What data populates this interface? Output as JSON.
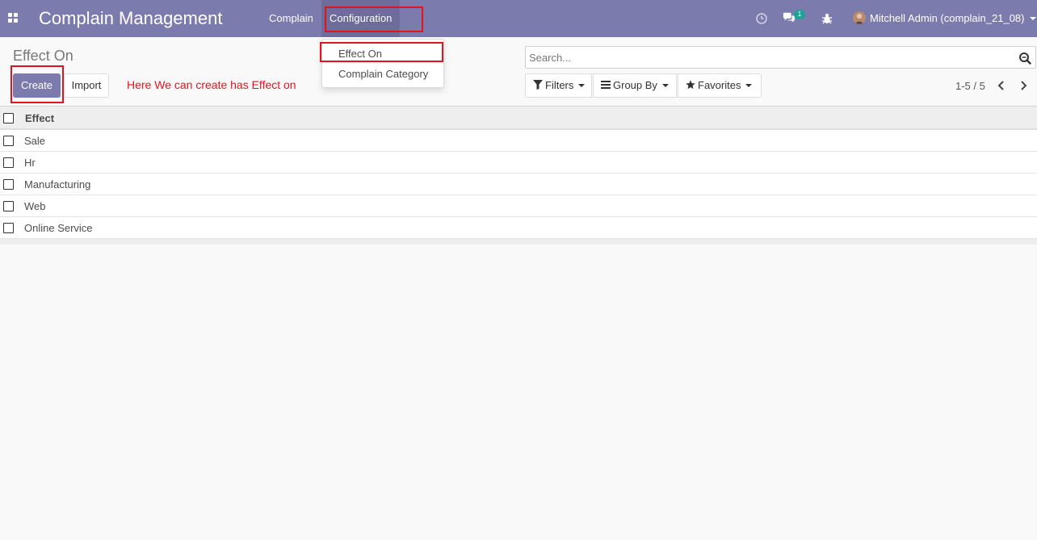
{
  "navbar": {
    "app_title": "Complain Management",
    "menu": [
      "Complain",
      "Configuration"
    ],
    "message_count": "1",
    "user_name": "Mitchell Admin (complain_21_08)"
  },
  "dropdown": {
    "items": [
      "Effect On",
      "Complain Category"
    ]
  },
  "control_panel": {
    "breadcrumb": "Effect On",
    "create_label": "Create",
    "import_label": "Import",
    "annotation": "Here We can create has Effect on",
    "search_placeholder": "Search...",
    "filters_label": "Filters",
    "groupby_label": "Group By",
    "favorites_label": "Favorites",
    "pager": "1-5 / 5"
  },
  "list": {
    "column": "Effect",
    "rows": [
      "Sale",
      "Hr",
      "Manufacturing",
      "Web",
      "Online Service"
    ]
  },
  "colors": {
    "brand": "#7c7bad",
    "annotation": "#e0141e",
    "badge": "#21a097"
  }
}
